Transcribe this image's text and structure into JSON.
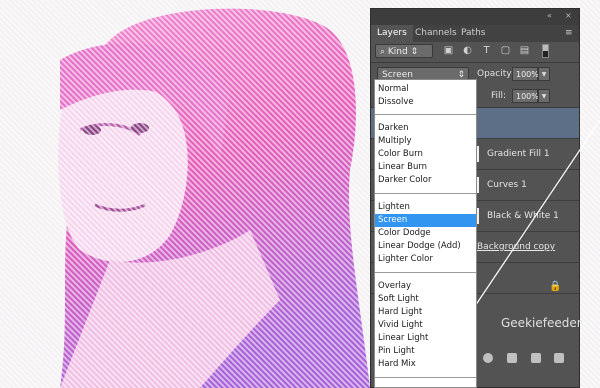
{
  "panel": {
    "tabs": [
      {
        "label": "Layers",
        "active": true
      },
      {
        "label": "Channels",
        "active": false
      },
      {
        "label": "Paths",
        "active": false
      }
    ],
    "window_controls": {
      "collapse": "«",
      "close": "×"
    },
    "menu_icon": "≡",
    "filter_kind": "Kind",
    "filter_icons": [
      "image-filter-icon",
      "adjustment-filter-icon",
      "type-filter-icon",
      "shape-filter-icon",
      "smart-object-filter-icon"
    ],
    "blend_mode": "Screen",
    "opacity_label": "Opacity:",
    "opacity_value": "100%",
    "fill_label": "Fill:",
    "fill_value": "100%",
    "layers": [
      {
        "name": "",
        "selected": true
      },
      {
        "name": "Gradient Fill 1",
        "selected": false
      },
      {
        "name": "Curves 1",
        "selected": false
      },
      {
        "name": "Black & White 1",
        "selected": false
      },
      {
        "name": "Background copy",
        "selected": false
      },
      {
        "name": "",
        "selected": false
      }
    ],
    "lock_icon": "lock-icon",
    "watermark": "Geekiefeeder"
  },
  "dropdown": {
    "groups": [
      [
        "Normal",
        "Dissolve"
      ],
      [
        "Darken",
        "Multiply",
        "Color Burn",
        "Linear Burn",
        "Darker Color"
      ],
      [
        "Lighten",
        "Screen",
        "Color Dodge",
        "Linear Dodge (Add)",
        "Lighter Color"
      ],
      [
        "Overlay",
        "Soft Light",
        "Hard Light",
        "Vivid Light",
        "Linear Light",
        "Pin Light",
        "Hard Mix"
      ]
    ],
    "selected": "Screen"
  },
  "colors": {
    "accent": "#3296f0",
    "panel": "#535353",
    "photo_pink": "#e96bc0",
    "photo_purple": "#9b5fd3"
  }
}
